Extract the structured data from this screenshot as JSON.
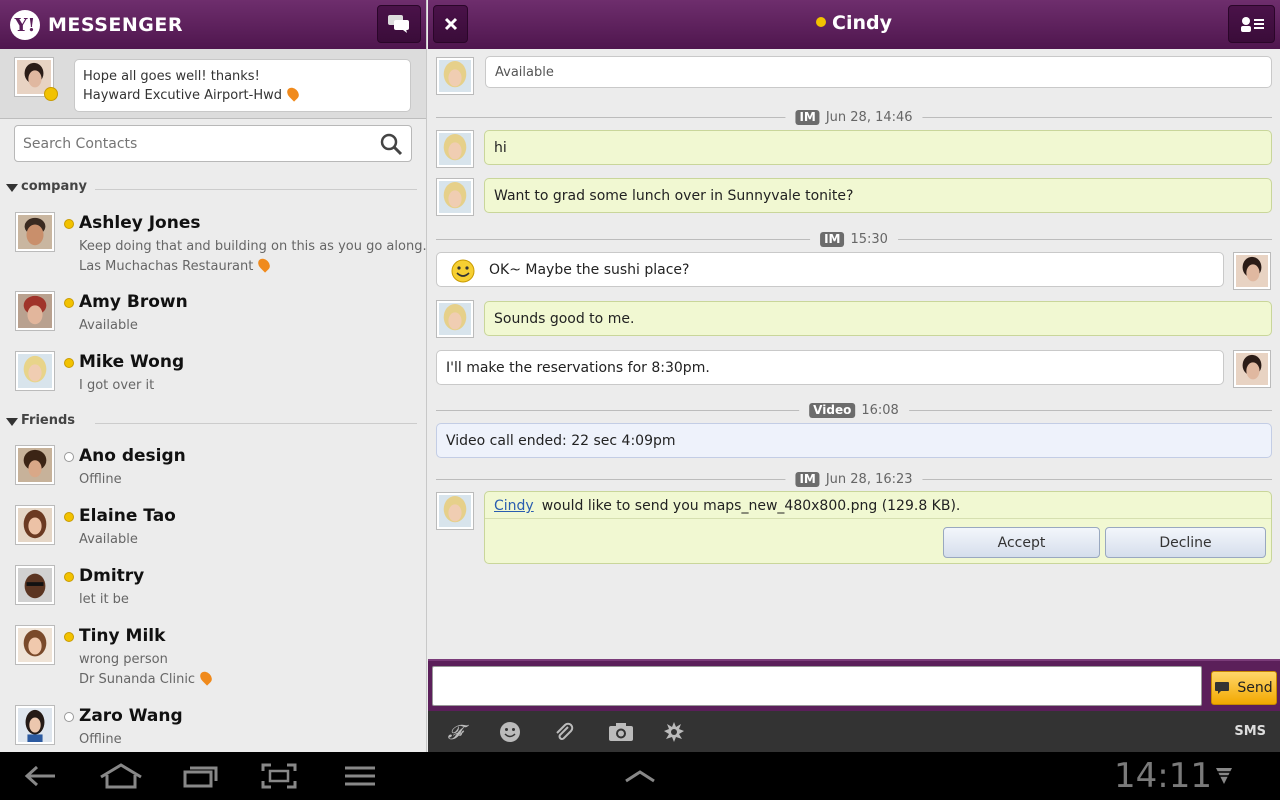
{
  "app": {
    "title": "MESSENGER"
  },
  "status": {
    "message": "Hope all goes well!  thanks!",
    "location": "Hayward Excutive Airport-Hwd"
  },
  "search": {
    "placeholder": "Search Contacts"
  },
  "groups": [
    {
      "label": "company"
    },
    {
      "label": "Friends"
    }
  ],
  "contacts": [
    {
      "name": "Ashley Jones",
      "status": "Keep doing that and building on this as you go along.",
      "location": "Las Muchachas Restaurant",
      "online": true
    },
    {
      "name": "Amy Brown",
      "status": "Available",
      "online": true
    },
    {
      "name": "Mike Wong",
      "status": "I got over it",
      "online": true
    },
    {
      "name": "Ano design",
      "status": "Offline",
      "online": false
    },
    {
      "name": "Elaine Tao",
      "status": "Available",
      "online": true
    },
    {
      "name": "Dmitry",
      "status": "let it be",
      "online": true
    },
    {
      "name": "Tiny Milk",
      "status": "wrong person",
      "location": "Dr Sunanda Clinic",
      "online": true
    },
    {
      "name": "Zaro Wang",
      "status": "Offline",
      "online": false
    }
  ],
  "chat": {
    "title": "Cindy",
    "presence": "Available",
    "separators": [
      {
        "badge": "IM",
        "time": "Jun 28, 14:46"
      },
      {
        "badge": "IM",
        "time": "15:30"
      },
      {
        "badge": "Video",
        "time": "16:08"
      },
      {
        "badge": "IM",
        "time": "Jun 28, 16:23"
      }
    ],
    "messages": [
      {
        "text": "hi"
      },
      {
        "text": "Want to grad some lunch over in Sunnyvale tonite?"
      },
      {
        "text": "OK~ Maybe the sushi place?"
      },
      {
        "text": "Sounds good to me."
      },
      {
        "text": "I'll make the reservations for 8:30pm."
      },
      {
        "text": "Video call ended: 22 sec 4:09pm"
      }
    ],
    "file_transfer": {
      "sender": "Cindy",
      "text": "would like to send you maps_new_480x800.png (129.8 KB).",
      "accept": "Accept",
      "decline": "Decline"
    }
  },
  "compose": {
    "value": "",
    "send": "Send",
    "sms": "SMS"
  },
  "system": {
    "clock": "14:11"
  },
  "colors": {
    "header": "#5b1f5a",
    "incoming": "#f1f8d2",
    "presence_online": "#f2c200",
    "send": "#f2a800"
  }
}
